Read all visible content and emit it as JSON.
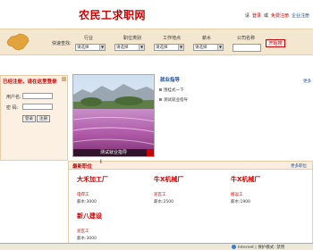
{
  "header": {
    "site_title": "农民工求职网",
    "greeting": "请",
    "login_link": "登录",
    "or_text": "或",
    "register_person": "免费注册",
    "register_company": "企业注册"
  },
  "search": {
    "label": "快速查找:",
    "fields": [
      {
        "label": "行业",
        "value": "请选择"
      },
      {
        "label": "职位类别",
        "value": "请选择"
      },
      {
        "label": "工作地点",
        "value": "请选择"
      },
      {
        "label": "薪水",
        "value": "请选择"
      }
    ],
    "company_label": "公司名称",
    "company_value": "",
    "button_label": "开始搜"
  },
  "login": {
    "title": "已经注册，请在这里登录",
    "username_label": "用户名:",
    "password_label": "密  码:",
    "login_button": "登录",
    "register_button": "注册"
  },
  "banner": {
    "caption": "测试就业指导"
  },
  "notice": {
    "title": "就业指导",
    "more": "更多",
    "items": [
      "围挂式一下",
      "测试就业指导"
    ]
  },
  "jobs": {
    "title": "最新职位",
    "more": "更多职位",
    "listings": [
      {
        "company": "大禾加工厂",
        "position": "电焊工",
        "salary": "薪水:3000"
      },
      {
        "company": "牛X机械厂",
        "position": "泥瓦工",
        "salary": "薪水:2500"
      },
      {
        "company": "牛X机械厂",
        "position": "搬运工",
        "salary": "薪水:1900"
      },
      {
        "company": "新八建设",
        "position": "泥瓦工",
        "salary": "薪水:3000"
      }
    ]
  },
  "statusbar": {
    "zone": "Internet | 保护模式: 禁用"
  },
  "colors": {
    "brand_red": "#cc0000",
    "link_blue": "#1a4fa0",
    "search_bar_bg": "#f4e7cf"
  }
}
